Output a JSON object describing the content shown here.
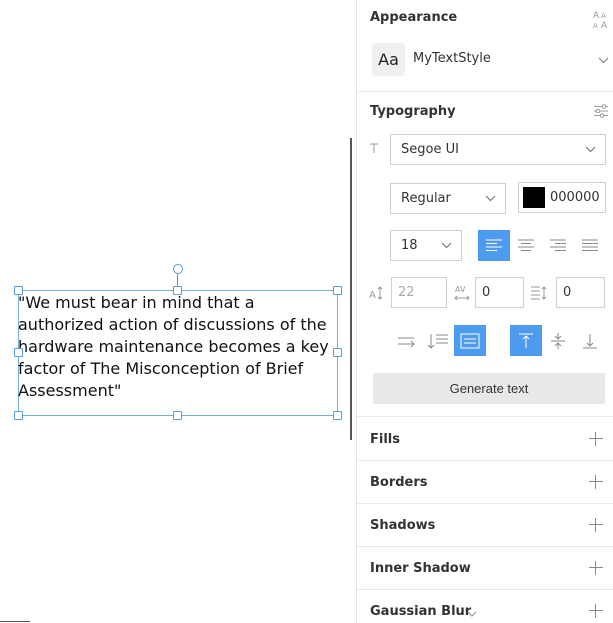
{
  "canvas": {
    "text_lines": [
      "\"We must bear in mind that a",
      "authorized action of discussions of the",
      "hardware maintenance becomes a key",
      "factor of The Misconception of Brief",
      "Assessment\""
    ]
  },
  "appearance": {
    "title": "Appearance",
    "preview": "Aa",
    "style_name": "MyTextStyle"
  },
  "typography": {
    "title": "Typography",
    "font_family": "Segoe UI",
    "font_weight": "Regular",
    "color_hex": "000000",
    "font_size": "18",
    "line_height": "22",
    "letter_spacing": "0",
    "paragraph_spacing": "0",
    "generate_label": "Generate text"
  },
  "sections": {
    "fills": "Fills",
    "borders": "Borders",
    "shadows": "Shadows",
    "inner_shadow": "Inner Shadow",
    "gaussian_blur": "Gaussian Blur"
  },
  "colors": {
    "accent": "#4d9bef",
    "selection": "#5b9be0"
  }
}
